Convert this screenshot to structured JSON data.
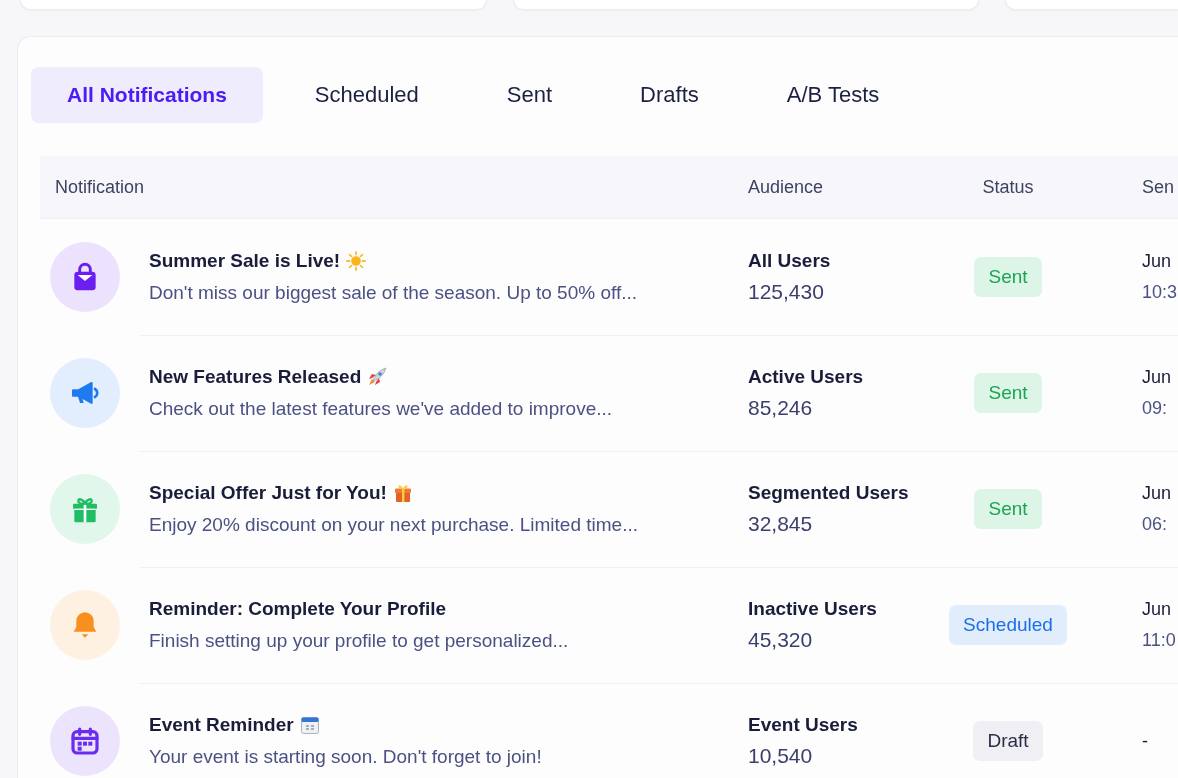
{
  "tabs": [
    {
      "label": "All Notifications",
      "selected": true
    },
    {
      "label": "Scheduled",
      "selected": false
    },
    {
      "label": "Sent",
      "selected": false
    },
    {
      "label": "Drafts",
      "selected": false
    },
    {
      "label": "A/B Tests",
      "selected": false
    }
  ],
  "table": {
    "columns": [
      "Notification",
      "Audience",
      "Status",
      "Sen"
    ],
    "rows": [
      {
        "title": "Summer Sale is Live!",
        "description": "Don't miss our biggest sale of the season. Up to 50% off...",
        "color": "#6a1ff0",
        "audience": {
          "name": "All Users",
          "count": "125,430"
        },
        "status": {
          "label": "Sent",
          "kind": "sent"
        },
        "sent": {
          "date": "Jun",
          "time": "10:3"
        }
      },
      {
        "title": "New Features Released",
        "description": "Check out the latest features we've added to improve...",
        "color": "#1f7af0",
        "audience": {
          "name": "Active Users",
          "count": "85,246"
        },
        "status": {
          "label": "Sent",
          "kind": "sent"
        },
        "sent": {
          "date": "Jun",
          "time": "09:"
        }
      },
      {
        "title": "Special Offer Just for You!",
        "description": "Enjoy 20% discount on your next purchase. Limited time...",
        "color": "#1fbe64",
        "audience": {
          "name": "Segmented Users",
          "count": "32,845"
        },
        "status": {
          "label": "Sent",
          "kind": "sent"
        },
        "sent": {
          "date": "Jun",
          "time": "06:"
        }
      },
      {
        "title": "Reminder: Complete Your Profile",
        "description": "Finish setting up your profile to get personalized...",
        "color": "#f7901e",
        "audience": {
          "name": "Inactive Users",
          "count": "45,320"
        },
        "status": {
          "label": "Scheduled",
          "kind": "scheduled"
        },
        "sent": {
          "date": "Jun",
          "time": "11:0"
        }
      },
      {
        "title": "Event Reminder",
        "description": "Your event is starting soon. Don't forget to join!",
        "color": "#6a2df0",
        "audience": {
          "name": "Event Users",
          "count": "10,540"
        },
        "status": {
          "label": "Draft",
          "kind": "draft"
        },
        "sent": {
          "date": "-"
        }
      }
    ]
  }
}
